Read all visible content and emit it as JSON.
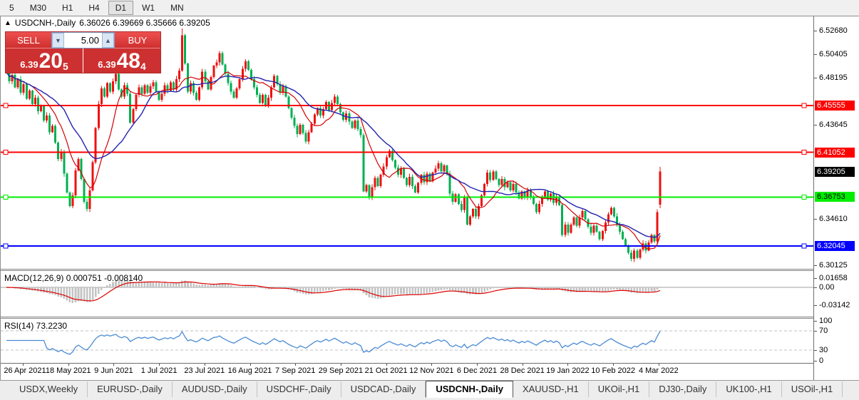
{
  "toolbar": {
    "timeframes": [
      "5",
      "M30",
      "H1",
      "H4",
      "D1",
      "W1",
      "MN"
    ],
    "active": "D1"
  },
  "chart": {
    "title": {
      "symbol_period": "USDCNH-,Daily",
      "ohlc": "6.36026 6.39669 6.35666 6.39205",
      "cursor_icon": "arrow-up"
    },
    "trade_panel": {
      "sell_label": "SELL",
      "buy_label": "BUY",
      "volume": "5.00",
      "sell_small": "6.39",
      "sell_big": "20",
      "sell_sup": "5",
      "buy_small": "6.39",
      "buy_big": "48",
      "buy_sup": "4"
    },
    "colors": {
      "bull": "#ef1010",
      "bear": "#00b050",
      "ma_fast": "#d40000",
      "ma_slow": "#2323b0",
      "hline_red": "#ff0000",
      "hline_green": "#00ee00",
      "hline_blue": "#0000ff",
      "macd_bar": "#c4c4c4",
      "macd_signal": "#dd0000",
      "rsi_line": "#4a8bd4"
    },
    "y_axis": {
      "ticks": [
        {
          "t": "6.52680",
          "v": 6.5268
        },
        {
          "t": "6.50405",
          "v": 6.50405
        },
        {
          "t": "6.48195",
          "v": 6.48195
        },
        {
          "t": "6.43645",
          "v": 6.43645
        },
        {
          "t": "6.34610",
          "v": 6.3461
        },
        {
          "t": "6.30125",
          "v": 6.30125
        }
      ],
      "badges": [
        {
          "t": "6.45555",
          "v": 6.45555,
          "bg": "#ff0000",
          "fg": "#ffffff"
        },
        {
          "t": "6.41052",
          "v": 6.41052,
          "bg": "#ff0000",
          "fg": "#ffffff"
        },
        {
          "t": "6.39205",
          "v": 6.39205,
          "bg": "#000000",
          "fg": "#ffffff"
        },
        {
          "t": "6.36753",
          "v": 6.36753,
          "bg": "#00ee00",
          "fg": "#000000"
        },
        {
          "t": "6.32045",
          "v": 6.32045,
          "bg": "#0000ff",
          "fg": "#ffffff"
        }
      ]
    },
    "h_lines": [
      {
        "price": 6.45555,
        "color": "#ff0000"
      },
      {
        "price": 6.41052,
        "color": "#ff0000"
      },
      {
        "price": 6.36753,
        "color": "#00ee00"
      },
      {
        "price": 6.32045,
        "color": "#0000ff"
      }
    ],
    "x_axis": [
      "26 Apr 2021",
      "18 May 2021",
      "9 Jun 2021",
      "1 Jul 2021",
      "23 Jul 2021",
      "16 Aug 2021",
      "7 Sep 2021",
      "29 Sep 2021",
      "21 Oct 2021",
      "12 Nov 2021",
      "6 Dec 2021",
      "28 Dec 2021",
      "19 Jan 2022",
      "10 Feb 2022",
      "4 Mar 2022"
    ]
  },
  "chart_data": {
    "type": "candlestick+indicators",
    "symbol": "USDCNH-",
    "period": "Daily",
    "last_ohlc": {
      "o": 6.36026,
      "h": 6.39669,
      "l": 6.35666,
      "c": 6.39205
    },
    "spike_high_index": 61,
    "spike_high": 6.5295,
    "ma_periods": [
      10,
      21
    ],
    "closes": [
      6.488,
      6.479,
      6.485,
      6.473,
      6.481,
      6.468,
      6.476,
      6.462,
      6.47,
      6.457,
      6.463,
      6.45,
      6.455,
      6.441,
      6.446,
      6.43,
      6.436,
      6.42,
      6.404,
      6.411,
      6.39,
      6.372,
      6.359,
      6.369,
      6.393,
      6.404,
      6.385,
      6.363,
      6.356,
      6.374,
      6.401,
      6.434,
      6.457,
      6.472,
      6.464,
      6.477,
      6.469,
      6.479,
      6.486,
      6.471,
      6.464,
      6.475,
      6.467,
      6.439,
      6.452,
      6.466,
      6.473,
      6.467,
      6.475,
      6.468,
      6.474,
      6.478,
      6.469,
      6.461,
      6.467,
      6.475,
      6.47,
      6.478,
      6.471,
      6.481,
      6.489,
      6.523,
      6.496,
      6.469,
      6.477,
      6.468,
      6.461,
      6.473,
      6.488,
      6.479,
      6.471,
      6.483,
      6.494,
      6.497,
      6.506,
      6.495,
      6.486,
      6.477,
      6.469,
      6.463,
      6.472,
      6.481,
      6.491,
      6.498,
      6.49,
      6.481,
      6.473,
      6.466,
      6.458,
      6.466,
      6.456,
      6.463,
      6.473,
      6.484,
      6.476,
      6.468,
      6.474,
      6.464,
      6.453,
      6.444,
      6.436,
      6.428,
      6.437,
      6.429,
      6.421,
      6.43,
      6.438,
      6.447,
      6.453,
      6.446,
      6.452,
      6.459,
      6.451,
      6.458,
      6.464,
      6.457,
      6.449,
      6.442,
      6.448,
      6.44,
      6.434,
      6.441,
      6.433,
      6.427,
      6.373,
      6.379,
      6.367,
      6.377,
      6.386,
      6.378,
      6.389,
      6.397,
      6.406,
      6.412,
      6.403,
      6.396,
      6.389,
      6.395,
      6.386,
      6.379,
      6.387,
      6.378,
      6.372,
      6.381,
      6.389,
      6.382,
      6.39,
      6.383,
      6.391,
      6.395,
      6.4,
      6.392,
      6.398,
      6.39,
      6.371,
      6.363,
      6.37,
      6.361,
      6.355,
      6.367,
      6.341,
      6.349,
      6.356,
      6.349,
      6.359,
      6.369,
      6.38,
      6.391,
      6.384,
      6.392,
      6.385,
      6.379,
      6.385,
      6.377,
      6.382,
      6.374,
      6.38,
      6.372,
      6.366,
      6.373,
      6.367,
      6.374,
      6.368,
      6.361,
      6.353,
      6.361,
      6.367,
      6.373,
      6.365,
      6.371,
      6.362,
      6.368,
      6.36,
      6.331,
      6.341,
      6.333,
      6.341,
      6.348,
      6.34,
      6.348,
      6.354,
      6.346,
      6.339,
      6.333,
      6.34,
      6.334,
      6.327,
      6.335,
      6.343,
      6.351,
      6.357,
      6.349,
      6.341,
      6.334,
      6.327,
      6.321,
      6.314,
      6.308,
      6.316,
      6.309,
      6.317,
      6.323,
      6.316,
      6.324,
      6.331,
      6.325,
      6.353,
      6.392
    ]
  },
  "macd": {
    "label": "MACD(12,26,9) 0.000751 -0.008140",
    "params": {
      "fast": 12,
      "slow": 26,
      "signal": 9
    },
    "main_value": 0.000751,
    "signal_value": -0.00814,
    "axis": [
      {
        "t": "0.01658",
        "v": 0.01658
      },
      {
        "t": "0.00",
        "v": 0
      },
      {
        "t": "-0.03142",
        "v": -0.03142
      }
    ]
  },
  "rsi": {
    "label": "RSI(14) 73.2230",
    "period": 14,
    "value": 73.223,
    "levels": [
      70,
      30
    ],
    "axis": [
      {
        "t": "100",
        "v": 100
      },
      {
        "t": "70",
        "v": 70
      },
      {
        "t": "30",
        "v": 30
      },
      {
        "t": "0",
        "v": 0
      }
    ]
  },
  "tabs": {
    "items": [
      "USDX,Weekly",
      "EURUSD-,Daily",
      "AUDUSD-,Daily",
      "USDCHF-,Daily",
      "USDCAD-,Daily",
      "USDCNH-,Daily",
      "XAUUSD-,H1",
      "UKOil-,H1",
      "DJ30-,Daily",
      "UK100-,H1",
      "USOil-,H1"
    ],
    "active_index": 5
  }
}
